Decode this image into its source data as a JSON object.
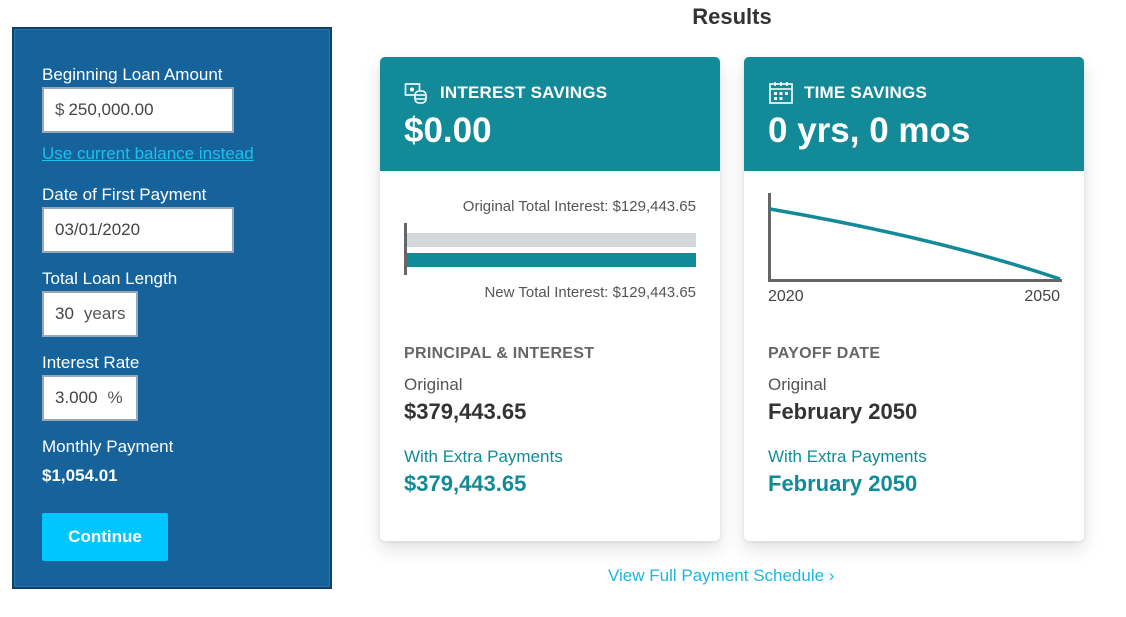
{
  "form": {
    "loan_amount_label": "Beginning Loan Amount",
    "loan_amount_prefix": "$",
    "loan_amount_value": "250,000.00",
    "use_balance_link": "Use current balance instead",
    "first_payment_label": "Date of First Payment",
    "first_payment_value": "03/01/2020",
    "loan_length_label": "Total Loan Length",
    "loan_length_value": "30",
    "loan_length_unit": "years",
    "interest_rate_label": "Interest Rate",
    "interest_rate_value": "3.000",
    "interest_rate_unit": "%",
    "monthly_payment_label": "Monthly Payment",
    "monthly_payment_value": "$1,054.01",
    "continue_label": "Continue"
  },
  "results": {
    "title": "Results",
    "interest_card": {
      "icon": "money-stack-icon",
      "label": "INTEREST SAVINGS",
      "value": "$0.00",
      "original_total_label": "Original Total Interest: $129,443.65",
      "new_total_label": "New Total Interest: $129,443.65",
      "original_total_fraction": 1.0,
      "new_total_fraction": 1.0,
      "section_title": "PRINCIPAL & INTEREST",
      "original_label": "Original",
      "original_value": "$379,443.65",
      "extra_label": "With Extra Payments",
      "extra_value": "$379,443.65"
    },
    "time_card": {
      "icon": "calendar-icon",
      "label": "TIME SAVINGS",
      "value": "0 yrs, 0 mos",
      "chart_start_year": "2020",
      "chart_end_year": "2050",
      "section_title": "PAYOFF DATE",
      "original_label": "Original",
      "original_value": "February 2050",
      "extra_label": "With Extra Payments",
      "extra_value": "February 2050"
    },
    "schedule_link": "View Full Payment Schedule ›"
  },
  "colors": {
    "panel_bg": "#15639a",
    "accent_teal": "#138a98",
    "button_cyan": "#00c6ff",
    "link_cyan": "#16c2f0",
    "bar_gray": "#d5d8db"
  }
}
